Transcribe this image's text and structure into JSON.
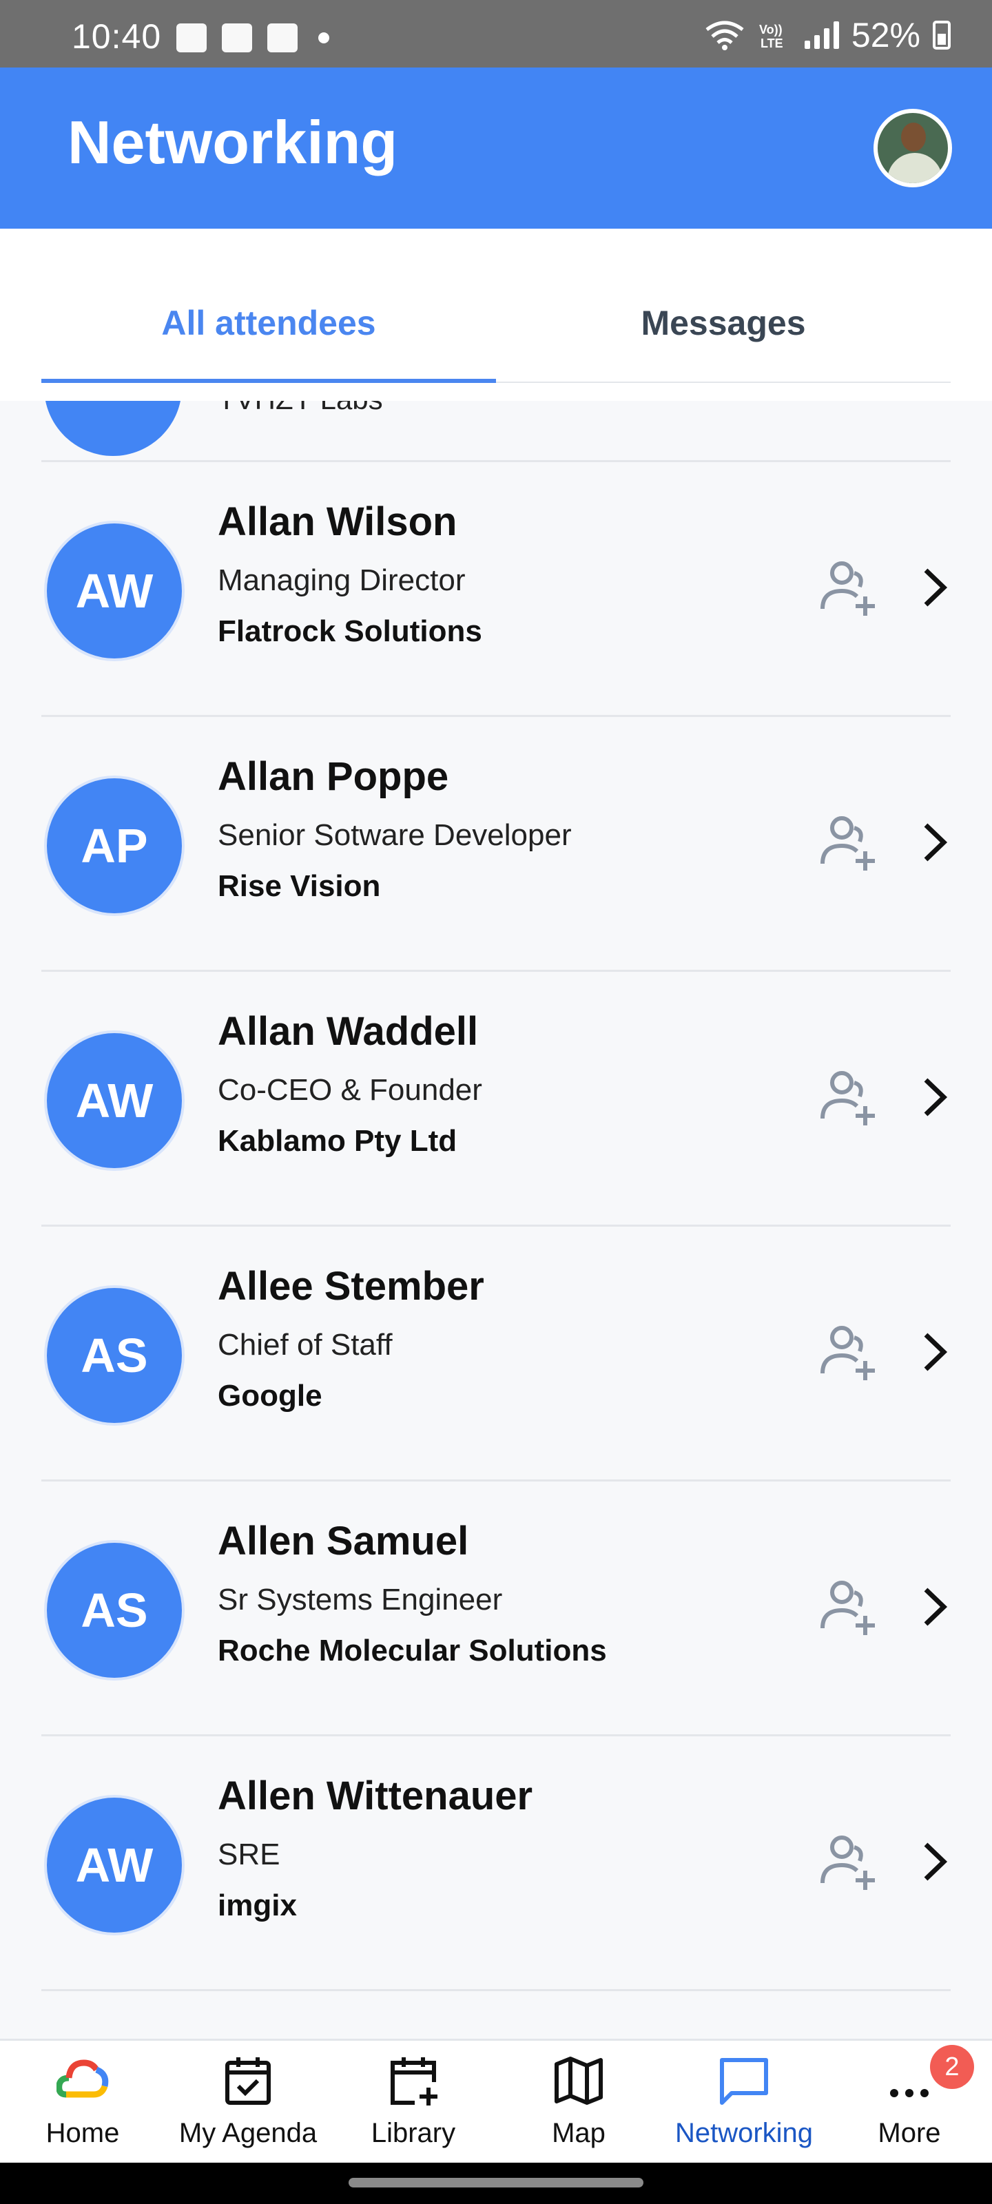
{
  "status_bar": {
    "time": "10:40",
    "battery": "52%"
  },
  "app_bar": {
    "title": "Networking"
  },
  "tabs": [
    {
      "label": "All attendees",
      "active": true
    },
    {
      "label": "Messages",
      "active": false
    }
  ],
  "attendees": [
    {
      "initials": "AW",
      "name": "Allan Wilson",
      "role": "Managing Director",
      "company": "Flatrock Solutions"
    },
    {
      "initials": "AP",
      "name": "Allan Poppe",
      "role": "Senior Sotware Developer",
      "company": "Rise Vision"
    },
    {
      "initials": "AW",
      "name": "Allan Waddell",
      "role": "Co-CEO & Founder",
      "company": "Kablamo Pty Ltd"
    },
    {
      "initials": "AS",
      "name": "Allee Stember",
      "role": "Chief of Staff",
      "company": "Google"
    },
    {
      "initials": "AS",
      "name": "Allen Samuel",
      "role": "Sr Systems Engineer",
      "company": "Roche Molecular Solutions"
    },
    {
      "initials": "AW",
      "name": "Allen Wittenauer",
      "role": "SRE",
      "company": "imgix"
    }
  ],
  "partial_row": {
    "company": "TVHZY Labs"
  },
  "bottom_nav": [
    {
      "label": "Home",
      "icon": "google-cloud-icon"
    },
    {
      "label": "My Agenda",
      "icon": "calendar-check-icon"
    },
    {
      "label": "Library",
      "icon": "calendar-add-icon"
    },
    {
      "label": "Map",
      "icon": "map-icon"
    },
    {
      "label": "Networking",
      "icon": "chat-icon",
      "active": true
    },
    {
      "label": "More",
      "icon": "more-icon",
      "badge": "2"
    }
  ],
  "colors": {
    "primary": "#4285f4",
    "badge": "#f25c54"
  }
}
